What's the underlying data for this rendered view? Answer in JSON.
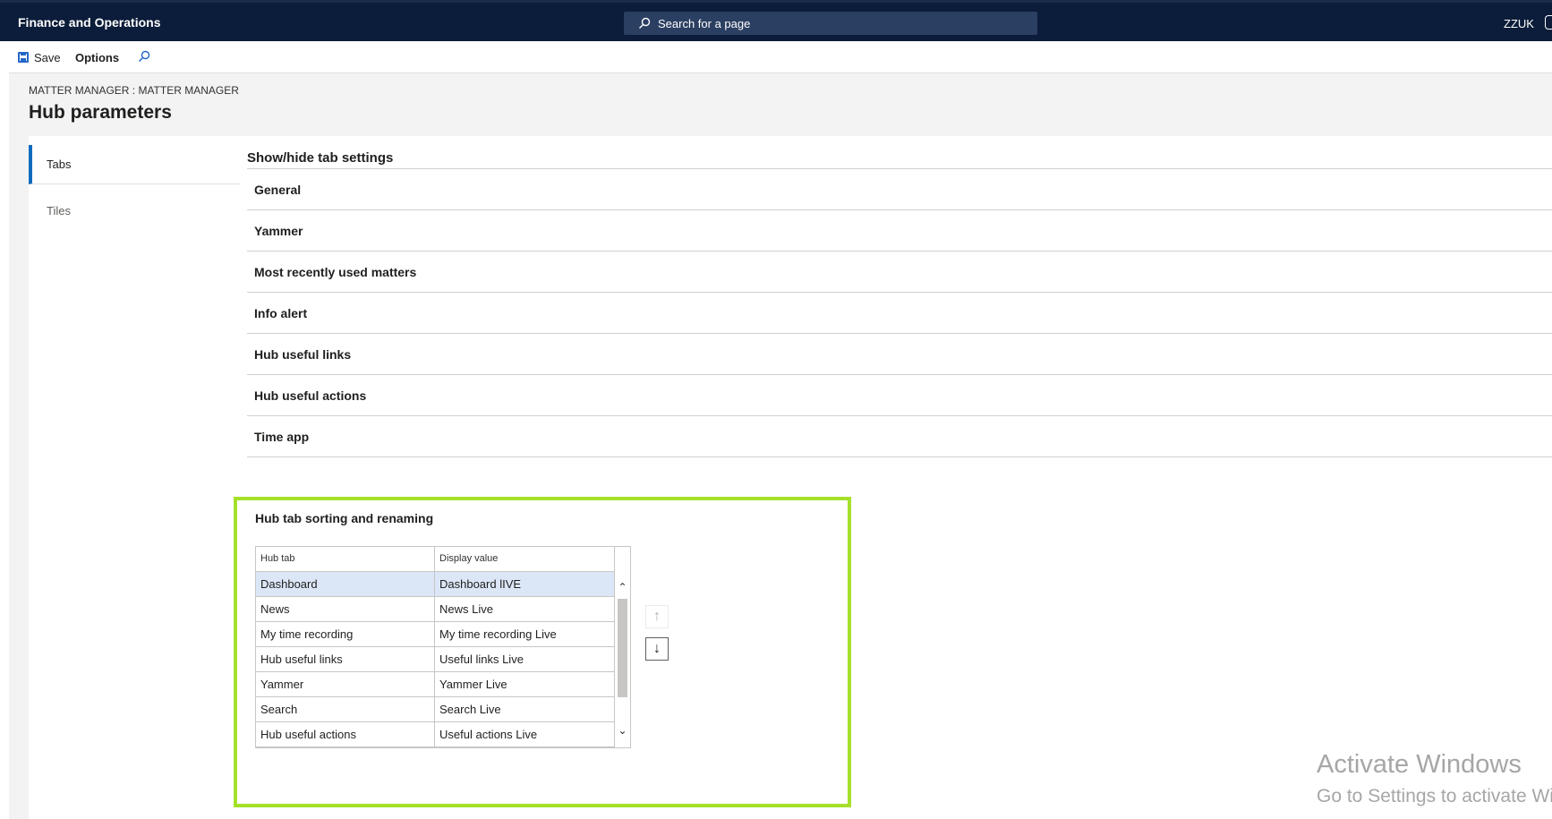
{
  "app": {
    "title": "Finance and Operations",
    "company": "ZZUK"
  },
  "search": {
    "placeholder": "Search for a page"
  },
  "actions": {
    "save_label": "Save",
    "options_label": "Options"
  },
  "header": {
    "breadcrumb": "MATTER MANAGER : MATTER MANAGER",
    "title": "Hub parameters"
  },
  "nav": {
    "items": [
      {
        "label": "Tabs"
      },
      {
        "label": "Tiles"
      }
    ]
  },
  "main": {
    "section_title": "Show/hide tab settings",
    "groups": [
      {
        "label": "General"
      },
      {
        "label": "Yammer"
      },
      {
        "label": "Most recently used matters"
      },
      {
        "label": "Info alert"
      },
      {
        "label": "Hub useful links"
      },
      {
        "label": "Hub useful actions"
      },
      {
        "label": "Time app"
      }
    ],
    "sorting": {
      "title": "Hub tab sorting and renaming",
      "columns": [
        "Hub tab",
        "Display value"
      ],
      "rows": [
        {
          "hub_tab": "Dashboard",
          "display_value": "Dashboard lIVE"
        },
        {
          "hub_tab": "News",
          "display_value": "News Live"
        },
        {
          "hub_tab": "My time recording",
          "display_value": "My time recording Live"
        },
        {
          "hub_tab": "Hub useful links",
          "display_value": "Useful links Live"
        },
        {
          "hub_tab": "Yammer",
          "display_value": "Yammer Live"
        },
        {
          "hub_tab": "Search",
          "display_value": "Search Live"
        },
        {
          "hub_tab": "Hub useful actions",
          "display_value": "Useful actions Live"
        }
      ]
    }
  },
  "watermark": {
    "line1": "Activate Windows",
    "line2": "Go to Settings to activate Windows."
  },
  "colors": {
    "topbar": "#0b1d3a",
    "accent": "#0f6cbd",
    "highlight": "#a5e02a",
    "selected_row": "#dbe6f7"
  }
}
